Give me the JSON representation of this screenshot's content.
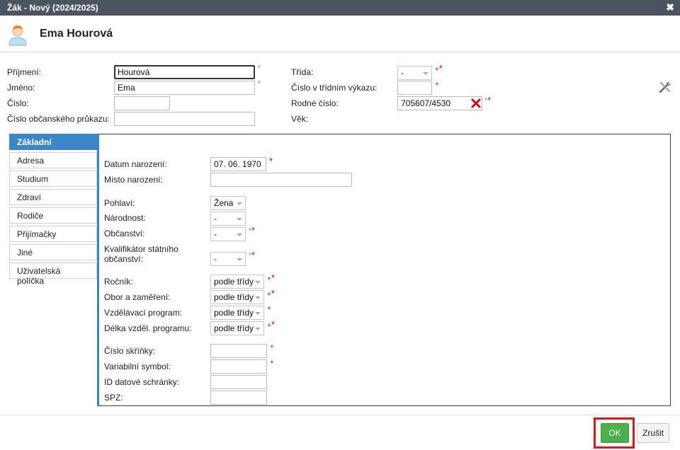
{
  "window": {
    "title": "Žák - Nový (2024/2025)"
  },
  "header": {
    "name": "Ema Hourová"
  },
  "top_form": {
    "surname_label": "Příjmení:",
    "surname_value": "Hourová",
    "firstname_label": "Jméno:",
    "firstname_value": "Ema",
    "number_label": "Číslo:",
    "number_value": "",
    "idcard_label": "Číslo občanského průkazu:",
    "idcard_value": "",
    "class_label": "Třída:",
    "class_value": "-",
    "report_number_label": "Číslo v třídním výkazu:",
    "report_number_value": "",
    "birth_number_label": "Rodné číslo:",
    "birth_number_value": "705607/4530",
    "age_label": "Věk:",
    "circle": "°",
    "plus": "+",
    "star": "*"
  },
  "tabs": [
    "Základní",
    "Adresa",
    "Studium",
    "Zdraví",
    "Rodiče",
    "Přijímačky",
    "Jiné",
    "Uživatelská políčka"
  ],
  "active_tab": "Základní",
  "basic": {
    "birth_date_label": "Datum narození:",
    "birth_date_value": "07. 06. 1970",
    "birth_place_label": "Místo narození:",
    "birth_place_value": "",
    "gender_label": "Pohlaví:",
    "gender_value": "Žena",
    "nationality_label": "Národnost:",
    "nationality_value": "-",
    "citizenship_label": "Občanství:",
    "citizenship_value": "-",
    "qualifier_label_1": "Kvalifikátor státního",
    "qualifier_label_2": "občanství:",
    "qualifier_value": "-",
    "grade_label": "Ročník:",
    "grade_value": "podle třídy",
    "field_label": "Obor a zaměření:",
    "field_value": "podle třídy",
    "program_label": "Vzdělávací program:",
    "program_value": "podle třídy",
    "length_label": "Délka vzděl. programu:",
    "length_value": "podle třídy",
    "locker_label": "Číslo skříňky:",
    "locker_value": "",
    "varsym_label": "Variabilní symbol:",
    "varsym_value": "",
    "databox_label": "ID datové schránky:",
    "databox_value": "",
    "spz_label": "SPZ:",
    "spz_value": ""
  },
  "footer": {
    "ok_label": "OK",
    "cancel_label": "Zrušit"
  },
  "colors": {
    "accent": "#3a86c8",
    "ok": "#4cae4c",
    "required": "#d0021b",
    "titlebar": "#4b5560",
    "highlight": "#e01616"
  },
  "icons": [
    "close-icon",
    "user-avatar-icon",
    "tools-icon",
    "clear-icon",
    "dropdown-arrow-icon"
  ]
}
